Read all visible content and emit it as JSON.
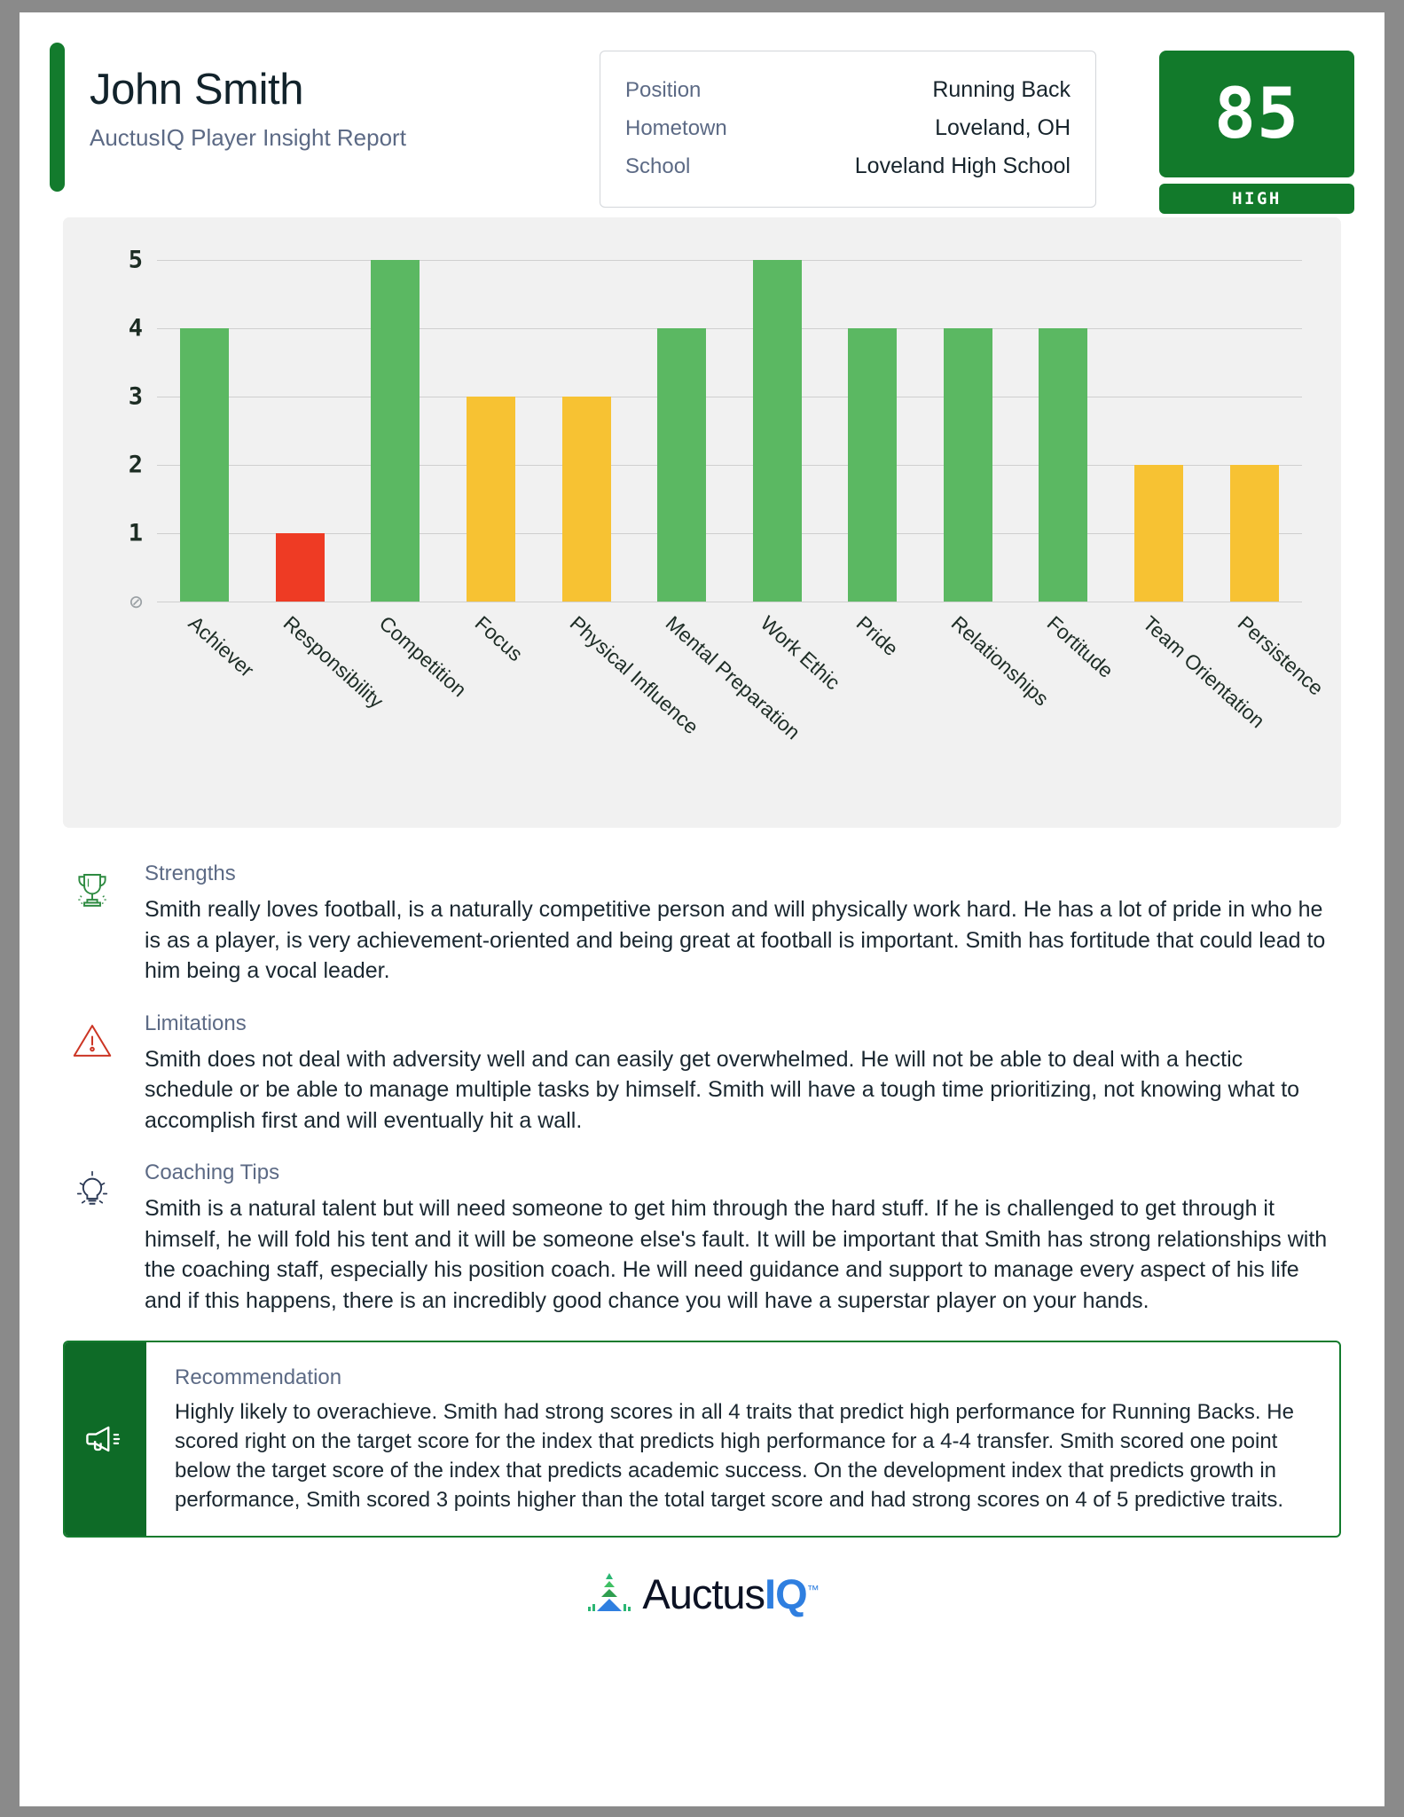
{
  "header": {
    "player_name": "John Smith",
    "report_subtitle": "AuctusIQ Player Insight Report",
    "info": [
      {
        "label": "Position",
        "value": "Running Back"
      },
      {
        "label": "Hometown",
        "value": "Loveland, OH"
      },
      {
        "label": "School",
        "value": "Loveland High School"
      }
    ],
    "score": "85",
    "score_band": "HIGH"
  },
  "chart_data": {
    "type": "bar",
    "title": "",
    "xlabel": "",
    "ylabel": "",
    "ylim": [
      0,
      5
    ],
    "yticks": [
      "5",
      "4",
      "3",
      "2",
      "1",
      "0"
    ],
    "zero_tick_glyph": "⊘",
    "grid": true,
    "legend": "none",
    "categories": [
      "Achiever",
      "Responsibility",
      "Competition",
      "Focus",
      "Physical Influence",
      "Mental Preparation",
      "Work Ethic",
      "Pride",
      "Relationships",
      "Fortitude",
      "Team Orientation",
      "Persistence"
    ],
    "values": [
      4,
      1,
      5,
      3,
      3,
      4,
      5,
      4,
      4,
      4,
      2,
      2
    ],
    "colors": [
      "#5BB862",
      "#EE3B24",
      "#5BB862",
      "#F7C233",
      "#F7C233",
      "#5BB862",
      "#5BB862",
      "#5BB862",
      "#5BB862",
      "#5BB862",
      "#F7C233",
      "#F7C233"
    ],
    "palette": {
      "high": "#5BB862",
      "mid": "#F7C233",
      "low": "#EE3B24"
    }
  },
  "sections": [
    {
      "icon": "trophy-icon",
      "title": "Strengths",
      "text": "Smith really loves football, is a naturally competitive person and will physically work hard. He has a lot of pride in who he is as a player, is very achievement-oriented and being great at football is important. Smith has fortitude that could lead to him being a vocal leader."
    },
    {
      "icon": "warning-triangle-icon",
      "title": "Limitations",
      "text": "Smith does not deal with adversity well and can easily get overwhelmed. He will not be able to deal with a hectic schedule or be able to manage multiple tasks by himself. Smith will have a tough time prioritizing, not knowing what to accomplish first and will eventually hit a wall."
    },
    {
      "icon": "lightbulb-icon",
      "title": "Coaching Tips",
      "text": "Smith is a natural talent but will need someone to get him through the hard stuff. If he is challenged to get through it himself, he will fold his tent and it will be someone else's fault. It will be important that Smith has strong relationships with the coaching staff, especially his position coach. He will need guidance and support to manage every aspect of his life and if this happens, there is an incredibly good chance you will have a superstar player on your hands."
    }
  ],
  "recommendation": {
    "icon": "megaphone-icon",
    "title": "Recommendation",
    "text": "Highly likely to overachieve. Smith had strong scores in all 4 traits that predict high performance for Running Backs. He scored right on the target score for the index that predicts high performance for a 4-4 transfer. Smith scored one point below the target score of the index that predicts academic success. On the development index that predicts growth in performance, Smith scored 3 points higher than the total target score and had strong scores on 4 of 5 predictive traits."
  },
  "footer": {
    "logo_name": "Auctus",
    "logo_accent": "IQ",
    "trademark": "™"
  },
  "colors": {
    "brand_green": "#137B2D",
    "accent_blue": "#2f7fe0",
    "label_slate": "#5c6a85"
  }
}
